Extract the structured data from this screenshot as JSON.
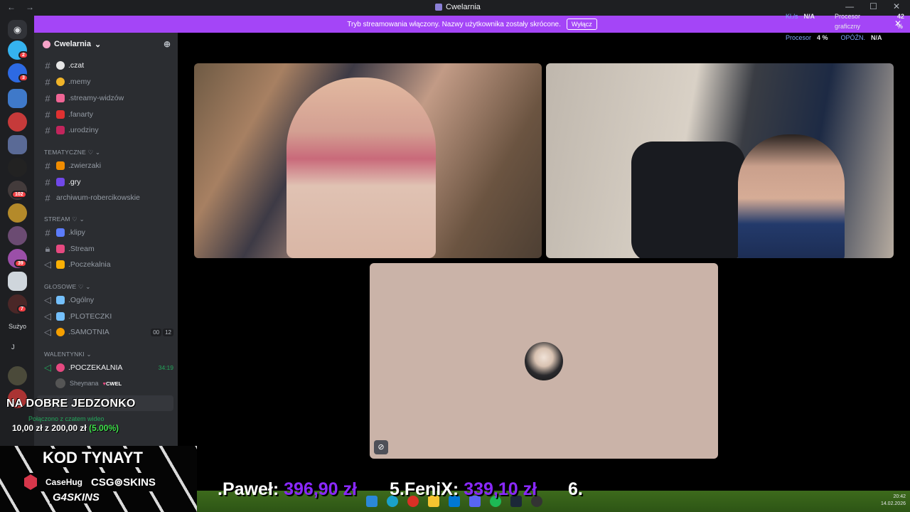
{
  "window": {
    "title": "Cwelarnia",
    "back": "←",
    "forward": "→",
    "minimize": "—",
    "maximize": "☐",
    "close": "✕"
  },
  "banner": {
    "text": "Tryb streamowania włączony. Nazwy użytkownika zostały skrócone.",
    "button": "Wyłącz",
    "close": "✕"
  },
  "stats": {
    "kls_label": "Kl./s",
    "kls_value": "N/A",
    "gpu_label": "Procesor graficzny",
    "gpu_value": "42 %",
    "cpu_label": "Procesor",
    "cpu_value": "4 %",
    "lat_label": "OPÓŹN.",
    "lat_value": "N/A"
  },
  "rail": {
    "badges": [
      "2",
      "3",
      "102",
      "39",
      "7"
    ],
    "label_suzyo": "Sużyo",
    "label_j": "J"
  },
  "server": {
    "name": "Cwelarnia",
    "chevron": "⌄",
    "add_member": "⊕"
  },
  "channels": {
    "czat": ".czat",
    "memy": ".memy",
    "streamy": ".streamy-widzów",
    "fanarty": ".fanarty",
    "urodziny": ".urodziny",
    "cat_tematyczne": "TEMATYCZNE ♡",
    "zwierzaki": ".zwierzaki",
    "gry": ".gry",
    "archiwum": "archiwum-robercikowskie",
    "cat_stream": "STREAM ♡",
    "klipy": ".klipy",
    "stream": ".Stream",
    "poczekalnia": ".Poczekalnia",
    "cat_glosowe": "GŁOSOWE ♡",
    "ogolny": ".Ogólny",
    "ploteczki": ".PLOTECZKI",
    "samotnia": ".SAMOTNIA",
    "samotnia_pill1": "00",
    "samotnia_pill2": "12",
    "cat_walentynki": "WALENTYNKI",
    "poczekalnia2": ".POCZEKALNIA",
    "poczekalnia2_time": "34:19",
    "member_name": "Sheynana",
    "member_tag": "CWEL"
  },
  "overlay": {
    "title": "NA DOBRE JEDZONKO",
    "voice_status": "Połączono z czatem wideo",
    "money_current": "10,00 zł",
    "money_sep": "z",
    "money_goal": "200,00 zł",
    "money_pct": "(5.00%)"
  },
  "promo": {
    "code": "KOD TYNAYT",
    "brand1": "CaseHug",
    "brand2": "CSG⊚SKINS",
    "brand3": "G4SKINS"
  },
  "ticker": {
    "name1": ".Paweł:",
    "amt1": "396,90 zł",
    "rank2": "5.",
    "name2": "FeniX:",
    "amt2": "339,10 zł",
    "rank3": "6."
  },
  "taskbar": {
    "time": "20:42",
    "date": "14.02.2026"
  },
  "colors": {
    "accent": "#a445f7",
    "online": "#23a55a",
    "badge": "#f23f43",
    "amount": "#8a28ff"
  }
}
